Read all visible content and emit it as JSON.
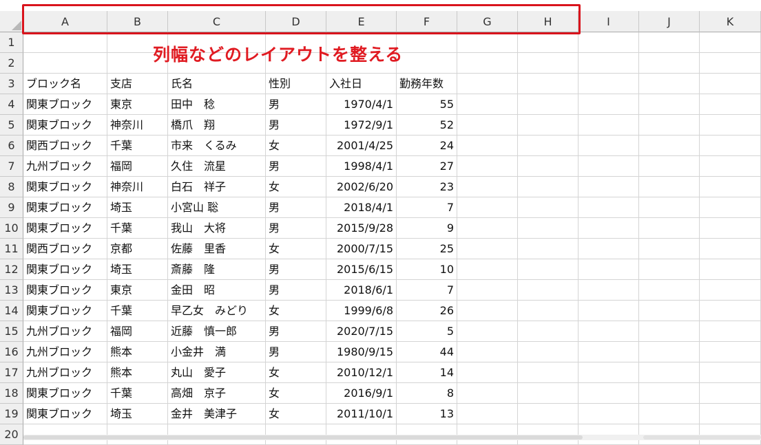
{
  "annotation": "列幅などのレイアウトを整える",
  "columns": [
    "A",
    "B",
    "C",
    "D",
    "E",
    "F",
    "G",
    "H",
    "I",
    "J",
    "K"
  ],
  "row_numbers": [
    "1",
    "2",
    "3",
    "4",
    "5",
    "6",
    "7",
    "8",
    "9",
    "10",
    "11",
    "12",
    "13",
    "14",
    "15",
    "16",
    "17",
    "18",
    "19",
    "20"
  ],
  "table": {
    "headers": [
      "ブロック名",
      "支店",
      "氏名",
      "性別",
      "入社日",
      "勤務年数"
    ],
    "rows": [
      [
        "関東ブロック",
        "東京",
        "田中　稔",
        "男",
        "1970/4/1",
        "55"
      ],
      [
        "関東ブロック",
        "神奈川",
        "橋爪　翔",
        "男",
        "1972/9/1",
        "52"
      ],
      [
        "関西ブロック",
        "千葉",
        "市来　くるみ",
        "女",
        "2001/4/25",
        "24"
      ],
      [
        "九州ブロック",
        "福岡",
        "久住　流星",
        "男",
        "1998/4/1",
        "27"
      ],
      [
        "関東ブロック",
        "神奈川",
        "白石　祥子",
        "女",
        "2002/6/20",
        "23"
      ],
      [
        "関東ブロック",
        "埼玉",
        "小宮山 聡",
        "男",
        "2018/4/1",
        "7"
      ],
      [
        "関東ブロック",
        "千葉",
        "我山　大将",
        "男",
        "2015/9/28",
        "9"
      ],
      [
        "関西ブロック",
        "京都",
        "佐藤　里香",
        "女",
        "2000/7/15",
        "25"
      ],
      [
        "関東ブロック",
        "埼玉",
        "斎藤　隆",
        "男",
        "2015/6/15",
        "10"
      ],
      [
        "関東ブロック",
        "東京",
        "金田　昭",
        "男",
        "2018/6/1",
        "7"
      ],
      [
        "関東ブロック",
        "千葉",
        "早乙女　みどり",
        "女",
        "1999/6/8",
        "26"
      ],
      [
        "九州ブロック",
        "福岡",
        "近藤　慎一郎",
        "男",
        "2020/7/15",
        "5"
      ],
      [
        "九州ブロック",
        "熊本",
        "小金井　満",
        "男",
        "1980/9/15",
        "44"
      ],
      [
        "九州ブロック",
        "熊本",
        "丸山　愛子",
        "女",
        "2010/12/1",
        "14"
      ],
      [
        "関東ブロック",
        "千葉",
        "高畑　京子",
        "女",
        "2016/9/1",
        "8"
      ],
      [
        "関東ブロック",
        "埼玉",
        "金井　美津子",
        "女",
        "2011/10/1",
        "13"
      ]
    ]
  },
  "icons": {
    "corner": "select-all-icon"
  },
  "colors": {
    "accent": "#e01b22",
    "header_bg": "#efefef",
    "gridline": "#d4d4d4"
  }
}
